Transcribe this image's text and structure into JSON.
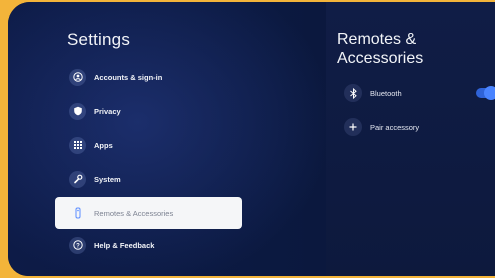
{
  "settings": {
    "title": "Settings",
    "items": [
      {
        "label": "Accounts & sign-in",
        "icon": "account-icon"
      },
      {
        "label": "Privacy",
        "icon": "shield-icon"
      },
      {
        "label": "Apps",
        "icon": "apps-grid-icon"
      },
      {
        "label": "System",
        "icon": "wrench-icon"
      },
      {
        "label": "Remotes & Accessories",
        "icon": "remote-icon",
        "selected": true
      },
      {
        "label": "Help & Feedback",
        "icon": "help-icon"
      }
    ]
  },
  "detail": {
    "title_line1": "Remotes &",
    "title_line2": "Accessories",
    "bluetooth": {
      "label": "Bluetooth",
      "icon": "bluetooth-icon",
      "enabled": true
    },
    "pair": {
      "label": "Pair accessory",
      "icon": "plus-icon"
    }
  },
  "colors": {
    "bezel": "#f3b43a",
    "background": "#0b1940",
    "selected_bg": "#f5f6f8",
    "toggle_on": "#4a84ff"
  }
}
